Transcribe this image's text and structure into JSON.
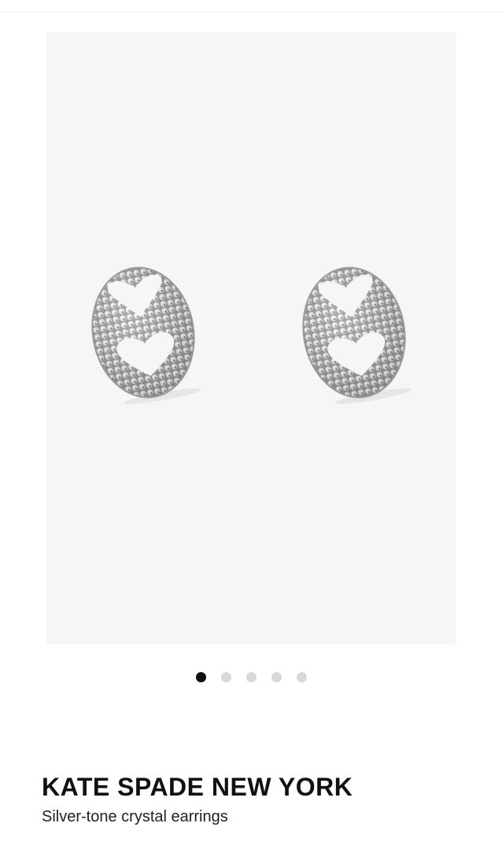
{
  "product": {
    "brand": "KATE SPADE NEW YORK",
    "name": "Silver-tone crystal earrings"
  },
  "gallery": {
    "image": "silver-heart-crystal-stud-earrings",
    "slide_count": 5,
    "active_slide": 1,
    "background": "#f6f6f6"
  },
  "colors": {
    "dot_active": "#111111",
    "dot_inactive": "#d8d8d8",
    "text": "#111111"
  }
}
